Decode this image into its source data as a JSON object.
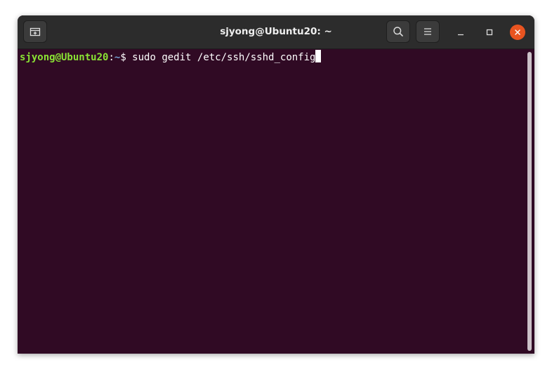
{
  "window": {
    "title": "sjyong@Ubuntu20: ~"
  },
  "titlebar": {
    "new_tab_icon": "new-tab-icon",
    "search_icon": "search-icon",
    "menu_icon": "hamburger-menu-icon",
    "minimize_icon": "minimize-icon",
    "maximize_icon": "maximize-icon",
    "close_icon": "close-icon"
  },
  "terminal": {
    "prompt_user": "sjyong@Ubuntu20",
    "prompt_colon": ":",
    "prompt_path": "~",
    "prompt_dollar": "$ ",
    "command": "sudo gedit /etc/ssh/sshd_config"
  },
  "colors": {
    "terminal_bg": "#300a24",
    "titlebar_bg": "#2c2c2c",
    "prompt_user": "#8ae234",
    "prompt_path": "#729fcf",
    "close_button": "#e95420"
  }
}
